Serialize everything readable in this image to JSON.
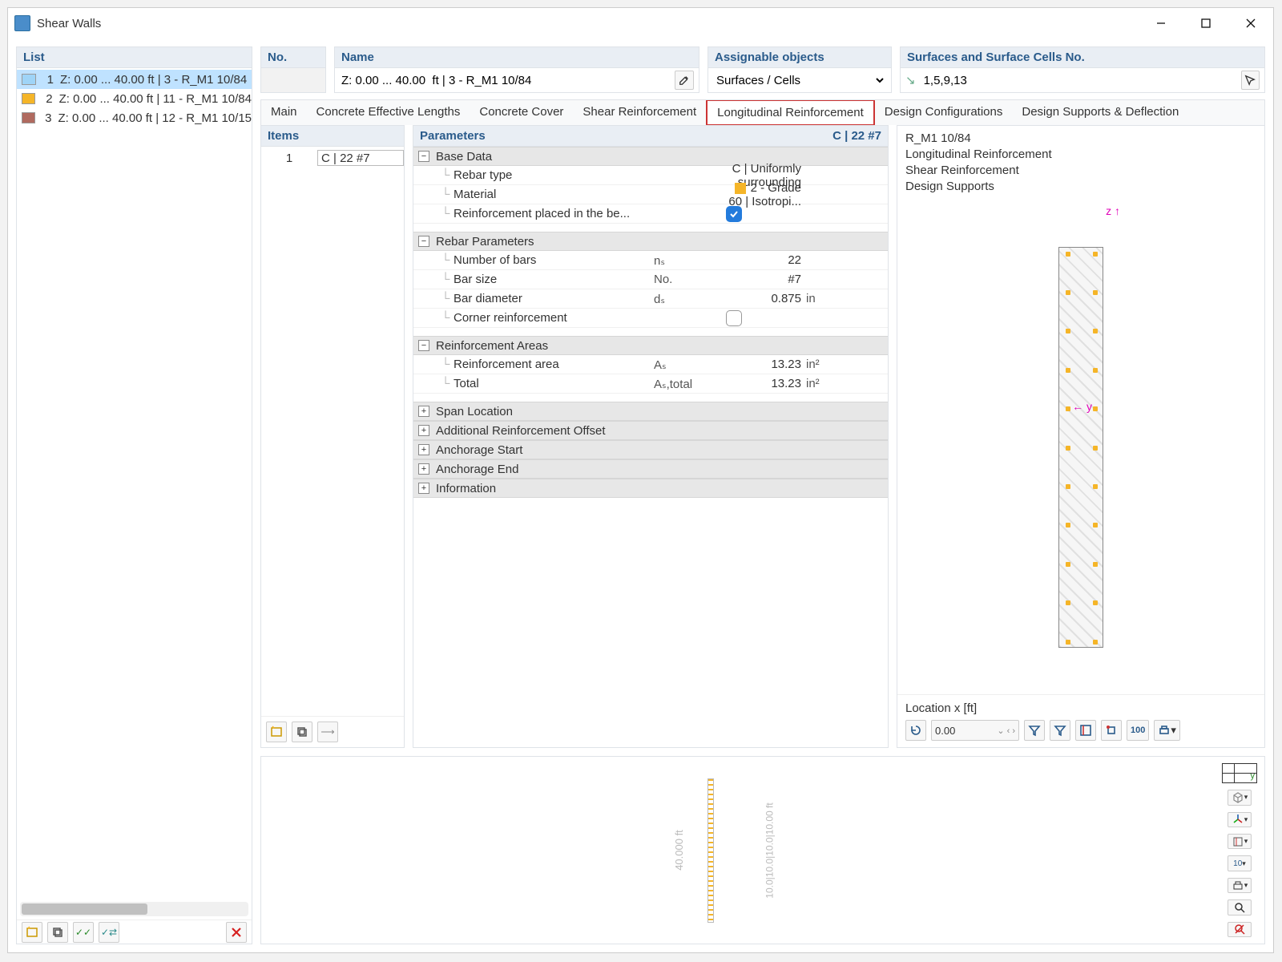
{
  "window": {
    "title": "Shear Walls"
  },
  "left": {
    "header": "List",
    "rows": [
      {
        "num": "1",
        "color": "#9fd4f7",
        "text": "Z: 0.00 ... 40.00 ft | 3 - R_M1 10/84",
        "selected": true
      },
      {
        "num": "2",
        "color": "#f5b528",
        "text": "Z: 0.00 ... 40.00 ft | 11 - R_M1 10/84",
        "selected": false
      },
      {
        "num": "3",
        "color": "#b06a5f",
        "text": "Z: 0.00 ... 40.00 ft | 12 - R_M1 10/15",
        "selected": false
      }
    ]
  },
  "header": {
    "no_label": "No.",
    "no_value": "",
    "name_label": "Name",
    "name_value": "Z: 0.00 ... 40.00  ft | 3 - R_M1 10/84",
    "obj_label": "Assignable objects",
    "obj_value": "Surfaces / Cells",
    "surf_label": "Surfaces and Surface Cells No.",
    "surf_value": "1,5,9,13"
  },
  "tabs": [
    {
      "label": "Main"
    },
    {
      "label": "Concrete Effective Lengths"
    },
    {
      "label": "Concrete Cover"
    },
    {
      "label": "Shear Reinforcement"
    },
    {
      "label": "Longitudinal Reinforcement",
      "active": true
    },
    {
      "label": "Design Configurations"
    },
    {
      "label": "Design Supports & Deflection"
    }
  ],
  "items": {
    "header": "Items",
    "rows": [
      {
        "num": "1",
        "val": "C | 22 #7"
      }
    ]
  },
  "params": {
    "header": "Parameters",
    "header_tag": "C | 22 #7",
    "groups": [
      {
        "name": "Base Data",
        "open": true,
        "props": [
          {
            "name": "Rebar type",
            "sym": "",
            "val": "C | Uniformly surrounding",
            "unit": ""
          },
          {
            "name": "Material",
            "sym": "",
            "val": "2 - Grade 60 | Isotropi...",
            "unit": "",
            "material": true
          },
          {
            "name": "Reinforcement placed in the be...",
            "sym": "",
            "val": "",
            "unit": "",
            "check": true
          }
        ]
      },
      {
        "name": "Rebar Parameters",
        "open": true,
        "props": [
          {
            "name": "Number of bars",
            "sym": "nₛ",
            "val": "22",
            "unit": ""
          },
          {
            "name": "Bar size",
            "sym": "No.",
            "val": "#7",
            "unit": ""
          },
          {
            "name": "Bar diameter",
            "sym": "dₛ",
            "val": "0.875",
            "unit": "in"
          },
          {
            "name": "Corner reinforcement",
            "sym": "",
            "val": "",
            "unit": "",
            "check_off": true
          }
        ]
      },
      {
        "name": "Reinforcement Areas",
        "open": true,
        "props": [
          {
            "name": "Reinforcement area",
            "sym": "Aₛ",
            "val": "13.23",
            "unit": "in²"
          },
          {
            "name": "Total",
            "sym": "Aₛ,total",
            "val": "13.23",
            "unit": "in²"
          }
        ]
      },
      {
        "name": "Span Location",
        "open": false
      },
      {
        "name": "Additional Reinforcement Offset",
        "open": false
      },
      {
        "name": "Anchorage Start",
        "open": false
      },
      {
        "name": "Anchorage End",
        "open": false
      },
      {
        "name": "Information",
        "open": false
      }
    ]
  },
  "preview": {
    "lines": [
      "R_M1 10/84",
      "Longitudinal Reinforcement",
      "Shear Reinforcement",
      "Design Supports"
    ],
    "axis_z": "z",
    "axis_y": "y",
    "location_label": "Location x [ft]",
    "location_value": "0.00"
  },
  "lower": {
    "dim_label_v": "40.000 ft",
    "dim_label_h": "10.0|10.0|10.0|10.00 ft",
    "side_label_y": "y",
    "side_num": "10"
  }
}
